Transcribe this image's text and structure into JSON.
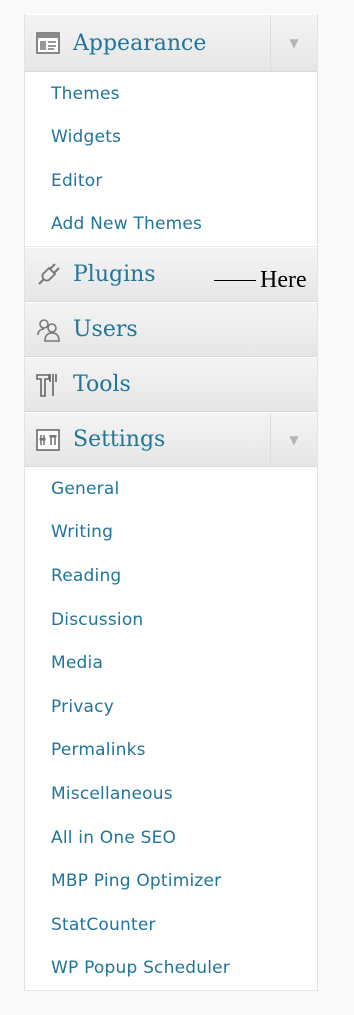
{
  "menu": {
    "appearance": {
      "label": "Appearance",
      "icon": "appearance-icon",
      "toggle_icon": "triangle-down-icon",
      "items": [
        "Themes",
        "Widgets",
        "Editor",
        "Add New Themes"
      ]
    },
    "plugins": {
      "label": "Plugins",
      "icon": "plugin-icon"
    },
    "users": {
      "label": "Users",
      "icon": "users-icon"
    },
    "tools": {
      "label": "Tools",
      "icon": "tools-icon"
    },
    "settings": {
      "label": "Settings",
      "icon": "settings-icon",
      "toggle_icon": "triangle-down-icon",
      "items": [
        "General",
        "Writing",
        "Reading",
        "Discussion",
        "Media",
        "Privacy",
        "Permalinks",
        "Miscellaneous",
        "All in One SEO",
        "MBP Ping Optimizer",
        "StatCounter",
        "WP Popup Scheduler"
      ]
    }
  },
  "annotation": {
    "text": "Here"
  },
  "colors": {
    "link": "#21759b",
    "header_bg": "#ececec",
    "toggle": "#b5b5b5"
  }
}
